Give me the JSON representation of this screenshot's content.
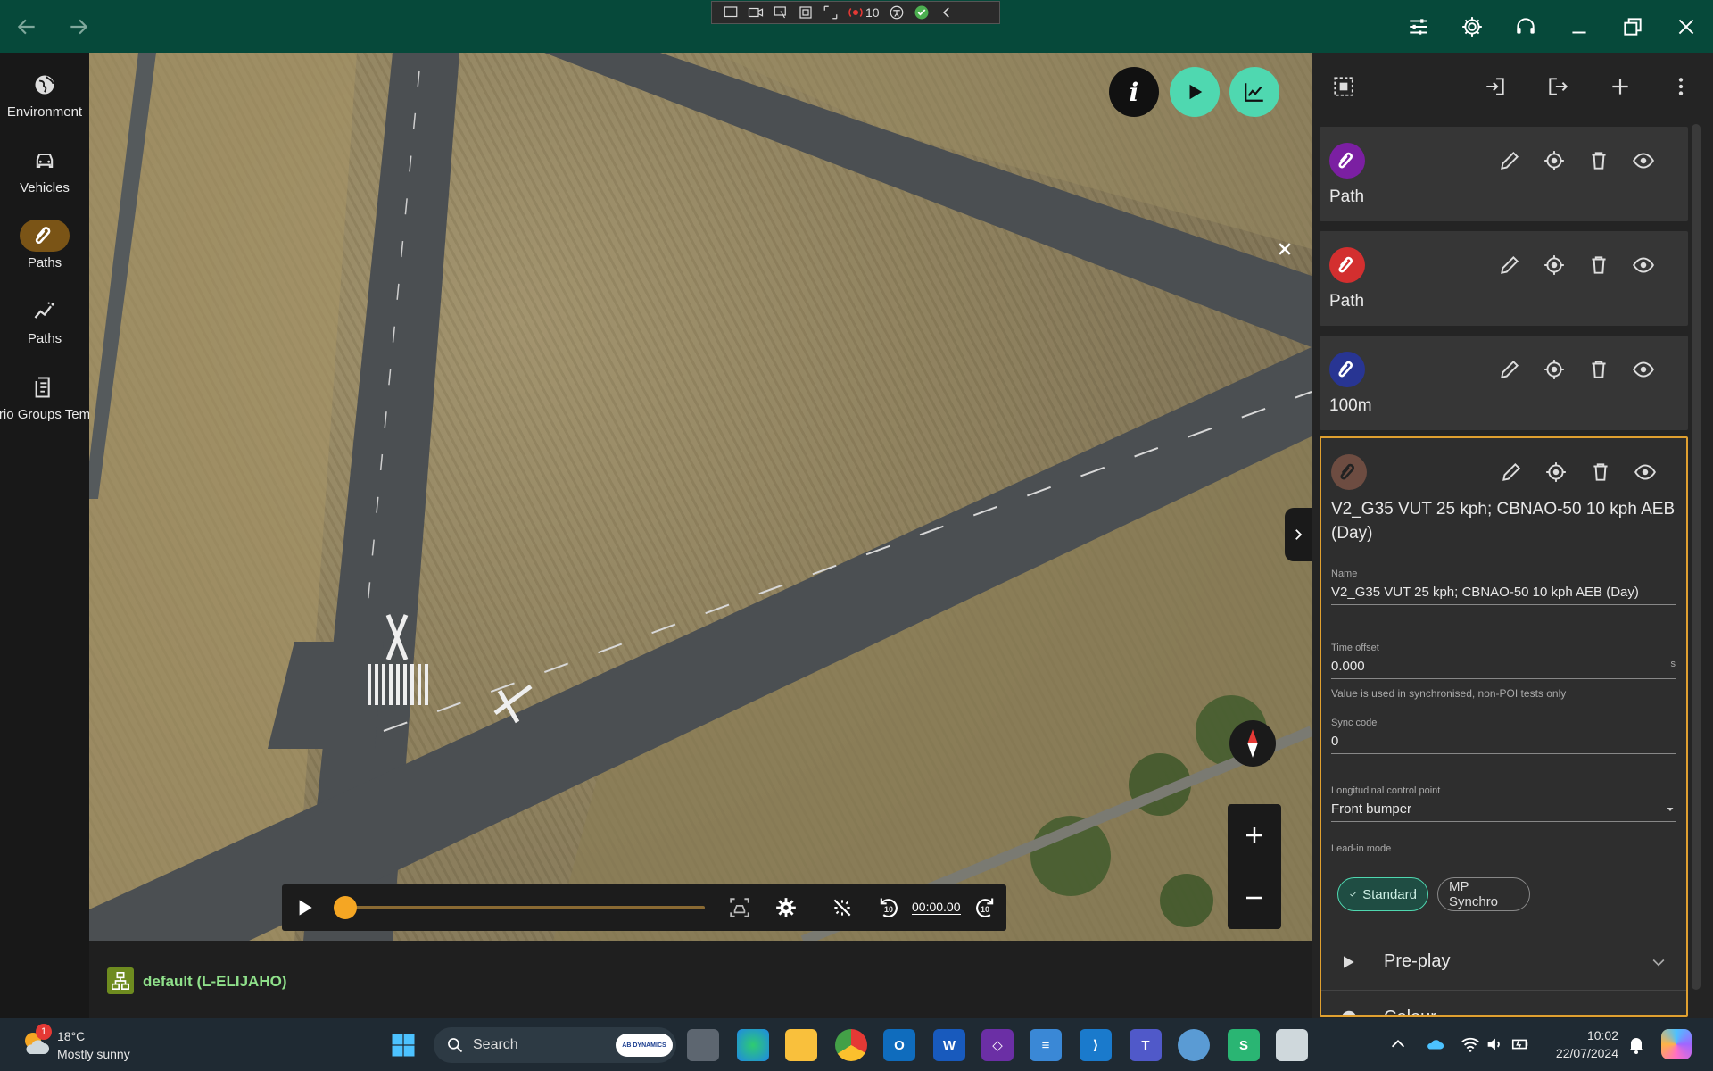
{
  "titlebar": {
    "remote_count": "10"
  },
  "nav": {
    "items": [
      {
        "label": "Environment",
        "icon": "globe-icon"
      },
      {
        "label": "Vehicles",
        "icon": "car-icon"
      },
      {
        "label": "Paths",
        "icon": "path-icon",
        "active": true
      },
      {
        "label": "Paths",
        "icon": "trend-icon"
      },
      {
        "label": "rio Groups Tem",
        "icon": "document-icon"
      }
    ]
  },
  "map": {
    "info_label": "i",
    "playback_time": "00:00.00",
    "skip_back_label": "10",
    "skip_forward_label": "10",
    "playback_progress_fraction": 0.0
  },
  "statusbar": {
    "project": "default (L-ELIJAHO)"
  },
  "paths": [
    {
      "name": "Path",
      "color": "#7b1fa2"
    },
    {
      "name": "Path",
      "color": "#d32f2f"
    },
    {
      "name": "100m",
      "color": "#283593"
    },
    {
      "name": "V2_G35 VUT 25 kph; CBNAO-50 10 kph AEB (Day)",
      "color": "#6d4c41"
    }
  ],
  "details": {
    "name_label": "Name",
    "name_value": "V2_G35 VUT 25 kph; CBNAO-50 10 kph AEB (Day)",
    "time_offset_label": "Time offset",
    "time_offset_value": "0.000",
    "time_offset_unit": "s",
    "time_offset_hint": "Value is used in synchronised, non-POI tests only",
    "sync_code_label": "Sync code",
    "sync_code_value": "0",
    "lcp_label": "Longitudinal control point",
    "lcp_value": "Front bumper",
    "leadin_label": "Lead-in mode",
    "leadin_options": [
      "Standard",
      "MP Synchro"
    ],
    "leadin_selected": "Standard",
    "section_preplay": "Pre-play",
    "section_colour": "Colour"
  },
  "taskbar": {
    "weather_temp": "18°C",
    "weather_desc": "Mostly sunny",
    "weather_badge": "1",
    "search_placeholder": "Search",
    "search_badge": "AB DYNAMICS",
    "time": "10:02",
    "date": "22/07/2024"
  },
  "colors": {
    "titlebar": "#06493a",
    "accent_teal": "#4fd8b0",
    "active_nav": "#7a5416",
    "selected_border": "#e0a030",
    "slider_thumb": "#f5a623"
  }
}
